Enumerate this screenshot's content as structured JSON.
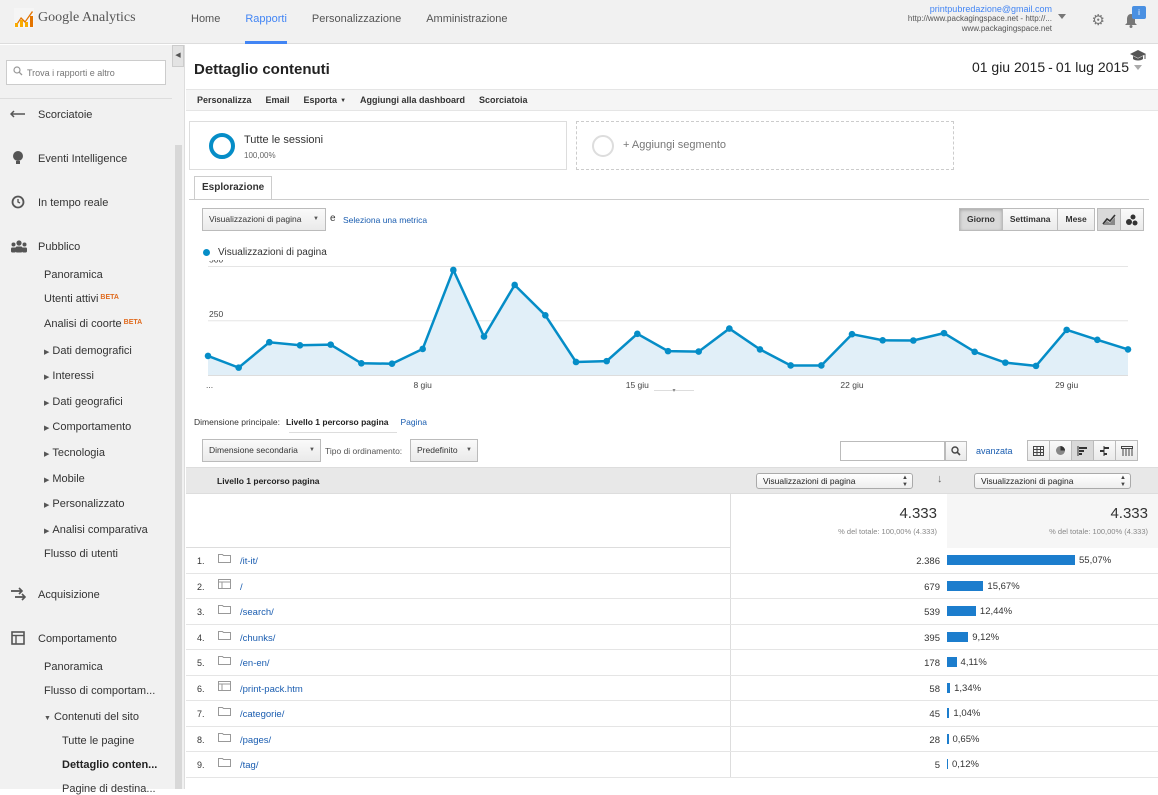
{
  "app": {
    "logo_text": "Google Analytics",
    "nav": [
      "Home",
      "Rapporti",
      "Personalizzazione",
      "Amministrazione"
    ],
    "nav_active": 1,
    "account_email": "printpubredazione@gmail.com",
    "account_line1": "http://www.packagingspace.net - http://...",
    "account_line2": "www.packagingspace.net",
    "notification_badge": "i"
  },
  "sidebar": {
    "search_placeholder": "Trova i rapporti e altro",
    "collapse_glyph": "◀",
    "top_items": [
      {
        "label": "Scorciatoie",
        "icon": "shortcut-arrows-icon"
      },
      {
        "label": "Eventi Intelligence",
        "icon": "lightbulb-icon"
      },
      {
        "label": "In tempo reale",
        "icon": "clock-icon"
      },
      {
        "label": "Pubblico",
        "icon": "people-icon"
      }
    ],
    "pubblico_sub": [
      {
        "label": "Panoramica",
        "beta": false,
        "expandable": false
      },
      {
        "label": "Utenti attivi",
        "beta": true,
        "expandable": false
      },
      {
        "label": "Analisi di coorte",
        "beta": true,
        "expandable": false
      },
      {
        "label": "Dati demografici",
        "beta": false,
        "expandable": true
      },
      {
        "label": "Interessi",
        "beta": false,
        "expandable": true
      },
      {
        "label": "Dati geografici",
        "beta": false,
        "expandable": true
      },
      {
        "label": "Comportamento",
        "beta": false,
        "expandable": true
      },
      {
        "label": "Tecnologia",
        "beta": false,
        "expandable": true
      },
      {
        "label": "Mobile",
        "beta": false,
        "expandable": true
      },
      {
        "label": "Personalizzato",
        "beta": false,
        "expandable": true
      },
      {
        "label": "Analisi comparativa",
        "beta": false,
        "expandable": true
      },
      {
        "label": "Flusso di utenti",
        "beta": false,
        "expandable": false
      }
    ],
    "beta_label": "BETA",
    "acquisizione": {
      "label": "Acquisizione",
      "icon": "acquisition-arrows-icon"
    },
    "comportamento": {
      "label": "Comportamento",
      "icon": "behavior-window-icon"
    },
    "comportamento_sub": [
      {
        "label": "Panoramica"
      },
      {
        "label": "Flusso di comportam..."
      },
      {
        "label": "Contenuti del sito",
        "expanded": true
      }
    ],
    "contenuti_sub": [
      {
        "label": "Tutte le pagine",
        "selected": false
      },
      {
        "label": "Dettaglio conten...",
        "selected": true
      },
      {
        "label": "Pagine di destina...",
        "selected": false
      }
    ]
  },
  "main": {
    "title": "Dettaglio contenuti",
    "date_start": "01 giu 2015",
    "date_sep": "-",
    "date_end": "01 lug 2015",
    "toolbar": [
      {
        "label": "Personalizza",
        "caret": false
      },
      {
        "label": "Email",
        "caret": false
      },
      {
        "label": "Esporta",
        "caret": true
      },
      {
        "label": "Aggiungi alla dashboard",
        "caret": false
      },
      {
        "label": "Scorciatoia",
        "caret": false
      }
    ],
    "segment_name": "Tutte le sessioni",
    "segment_pct": "100,00%",
    "add_segment": "+ Aggiungi segmento",
    "tab": "Esplorazione",
    "metric_select": "Visualizzazioni di pagina",
    "metric_and": "e",
    "metric_link": "Seleziona una metrica",
    "periods": [
      "Giorno",
      "Settimana",
      "Mese"
    ],
    "period_active": 0,
    "primary_dim_label": "Dimensione principale:",
    "primary_dim_selected": "Livello 1 percorso pagina",
    "primary_dim_other": "Pagina",
    "secondary_dim": "Dimensione secondaria",
    "sort_label": "Tipo di ordinamento:",
    "sort_value": "Predefinito",
    "advanced_link": "avanzata"
  },
  "chart_data": {
    "type": "line",
    "title": "",
    "legend": [
      "Visualizzazioni di pagina"
    ],
    "series": [
      {
        "name": "Visualizzazioni di pagina",
        "values": [
          88,
          34,
          151,
          137,
          140,
          54,
          52,
          120,
          484,
          177,
          415,
          275,
          60,
          64,
          190,
          110,
          108,
          214,
          118,
          44,
          44,
          188,
          160,
          159,
          193,
          107,
          57,
          42,
          208,
          162,
          118
        ]
      }
    ],
    "x_ticks": [
      {
        "label": "...",
        "index": 0
      },
      {
        "label": "8 giu",
        "index": 7
      },
      {
        "label": "15 giu",
        "index": 14
      },
      {
        "label": "22 giu",
        "index": 21
      },
      {
        "label": "29 giu",
        "index": 28
      }
    ],
    "y_ticks": [
      250,
      500
    ],
    "ylim": [
      0,
      530
    ],
    "color": "#058dc7",
    "fill": "#e1eff8"
  },
  "table": {
    "dim_header": "Livello 1 percorso pagina",
    "metric_header_1": "Visualizzazioni di pagina",
    "metric_header_2": "Visualizzazioni di pagina",
    "total_1": "4.333",
    "total_1_sub": "% del totale: 100,00% (4.333)",
    "total_2": "4.333",
    "total_2_sub": "% del totale: 100,00% (4.333)",
    "rows": [
      {
        "n": "1.",
        "path": "/it-it/",
        "icon": "folder-icon",
        "views": "2.386",
        "pct": "55,07%",
        "share": 55.07
      },
      {
        "n": "2.",
        "path": "/",
        "icon": "page-icon",
        "views": "679",
        "pct": "15,67%",
        "share": 15.67
      },
      {
        "n": "3.",
        "path": "/search/",
        "icon": "folder-icon",
        "views": "539",
        "pct": "12,44%",
        "share": 12.44
      },
      {
        "n": "4.",
        "path": "/chunks/",
        "icon": "folder-icon",
        "views": "395",
        "pct": "9,12%",
        "share": 9.12
      },
      {
        "n": "5.",
        "path": "/en-en/",
        "icon": "folder-icon",
        "views": "178",
        "pct": "4,11%",
        "share": 4.11
      },
      {
        "n": "6.",
        "path": "/print-pack.htm",
        "icon": "page-icon",
        "views": "58",
        "pct": "1,34%",
        "share": 1.34
      },
      {
        "n": "7.",
        "path": "/categorie/",
        "icon": "folder-icon",
        "views": "45",
        "pct": "1,04%",
        "share": 1.04
      },
      {
        "n": "8.",
        "path": "/pages/",
        "icon": "folder-icon",
        "views": "28",
        "pct": "0,65%",
        "share": 0.65
      },
      {
        "n": "9.",
        "path": "/tag/",
        "icon": "folder-icon",
        "views": "5",
        "pct": "0,12%",
        "share": 0.12
      }
    ]
  }
}
